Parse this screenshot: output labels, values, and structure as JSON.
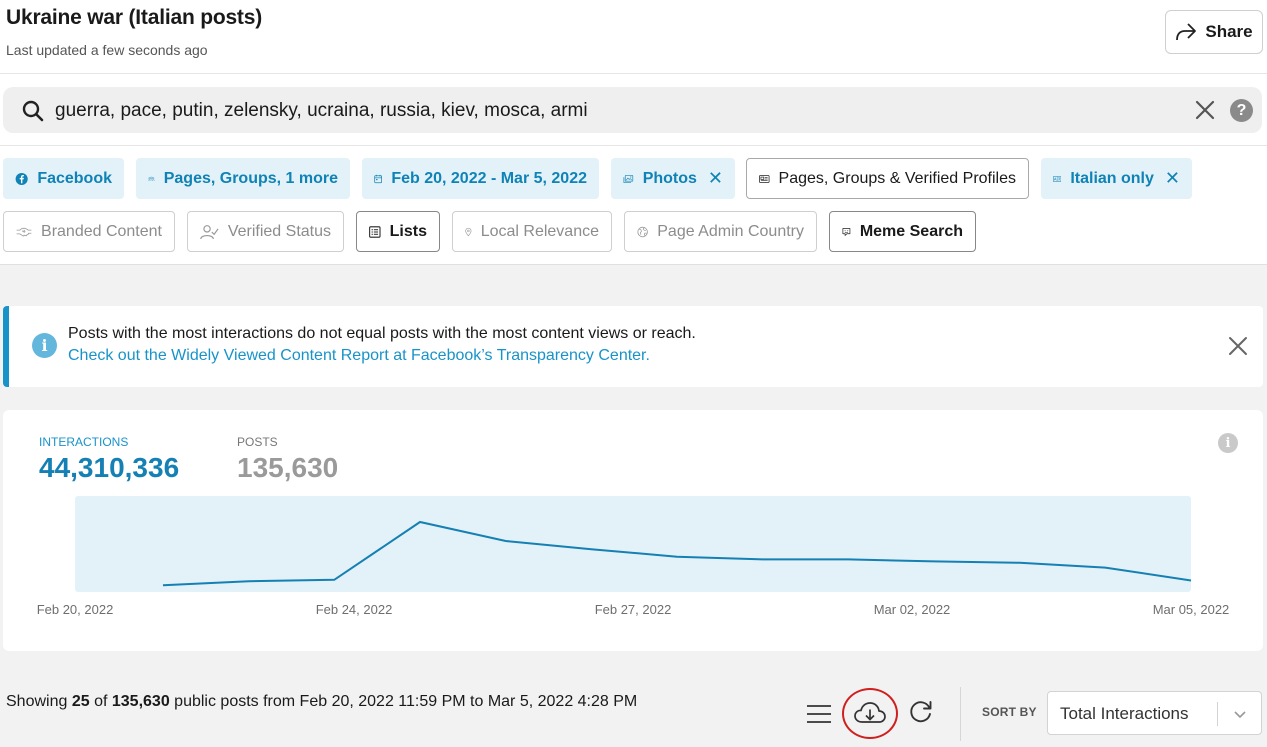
{
  "header": {
    "title": "Ukraine war (Italian posts)",
    "subtitle": "Last updated a few seconds ago",
    "share_label": "Share"
  },
  "search": {
    "query": "guerra, pace, putin, zelensky, ucraina, russia, kiev, mosca, armi",
    "help_label": "?"
  },
  "filters": {
    "row1": [
      {
        "label": "Facebook",
        "icon": "facebook-icon"
      },
      {
        "label": "Pages, Groups, 1 more",
        "icon": "people-icon"
      },
      {
        "label": "Feb 20, 2022 - Mar 5, 2022",
        "icon": "calendar-icon"
      },
      {
        "label": "Photos",
        "icon": "photos-icon",
        "removable": true
      },
      {
        "label": "Pages, Groups & Verified Profiles",
        "icon": "newspaper-icon"
      },
      {
        "label": "Italian only",
        "icon": "translate-icon",
        "removable": true
      }
    ],
    "row2": [
      {
        "label": "Branded Content",
        "icon": "handshake-icon",
        "enabled": false
      },
      {
        "label": "Verified Status",
        "icon": "verified-user-icon",
        "enabled": false
      },
      {
        "label": "Lists",
        "icon": "list-icon",
        "enabled": true
      },
      {
        "label": "Local Relevance",
        "icon": "location-pin-icon",
        "enabled": false
      },
      {
        "label": "Page Admin Country",
        "icon": "globe-icon",
        "enabled": false
      },
      {
        "label": "Meme Search",
        "icon": "meme-icon",
        "enabled": true
      }
    ]
  },
  "banner": {
    "line1": "Posts with the most interactions do not equal posts with the most content views or reach.",
    "link": "Check out the Widely Viewed Content Report at Facebook’s Transparency Center."
  },
  "metrics": {
    "interactions_label": "INTERACTIONS",
    "interactions_value": "44,310,336",
    "posts_label": "POSTS",
    "posts_value": "135,630"
  },
  "chart_data": {
    "type": "area",
    "x_ticks": [
      "Feb 20, 2022",
      "Feb 24, 2022",
      "Feb 27, 2022",
      "Mar 02, 2022",
      "Mar 05, 2022"
    ],
    "series": [
      {
        "values": [
          0.07,
          0.13,
          0.15,
          1.0,
          0.72,
          0.6,
          0.49,
          0.45,
          0.45,
          0.42,
          0.4,
          0.33,
          0.14
        ]
      }
    ],
    "colors": {
      "line": "#1480b3",
      "fill": "#e3f1f8"
    }
  },
  "footer": {
    "showing_prefix": "Showing",
    "count": "25",
    "of": "of",
    "total": "135,630",
    "suffix": "public posts from Feb 20, 2022 11:59 PM to Mar 5, 2022 4:28 PM"
  },
  "sort": {
    "label": "SORT BY",
    "value": "Total Interactions"
  }
}
